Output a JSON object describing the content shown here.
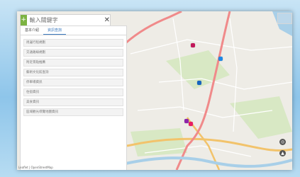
{
  "search": {
    "placeholder": "輸入關鍵字",
    "clear_icon": "close-icon",
    "menu_icon": "plus-icon"
  },
  "panel": {
    "tabs": [
      {
        "label": "基本介紹"
      },
      {
        "label": "資訊查詢"
      }
    ],
    "items": [
      {
        "label": "周邊行程規劃"
      },
      {
        "label": "交通路線規劃"
      },
      {
        "label": "附近景點推薦"
      },
      {
        "label": "藝術文化館查詢"
      },
      {
        "label": "停車場資訊"
      },
      {
        "label": "住宿資訊"
      },
      {
        "label": "美食資訊"
      },
      {
        "label": "區域觀光導覽地圖資訊"
      }
    ]
  },
  "map": {
    "footer": "Leaflet | OpenStreetMap",
    "controls": [
      {
        "icon": "locate-icon"
      },
      {
        "icon": "compass-icon"
      }
    ],
    "colors": {
      "road_major": "#f08a8a",
      "road_trunk": "#f2c36b",
      "river": "#a8cfe8",
      "green": "#cfe3b5",
      "water_body": "#7fb7e0"
    },
    "badges": [
      {
        "color": "#c2185b",
        "icon": "museum-icon"
      },
      {
        "color": "#1e88e5",
        "icon": "bus-icon"
      },
      {
        "color": "#1565c0",
        "icon": "car-icon"
      },
      {
        "color": "#8e24aa",
        "icon": "hotel-icon"
      },
      {
        "color": "#e91e63",
        "icon": "food-icon"
      }
    ]
  }
}
